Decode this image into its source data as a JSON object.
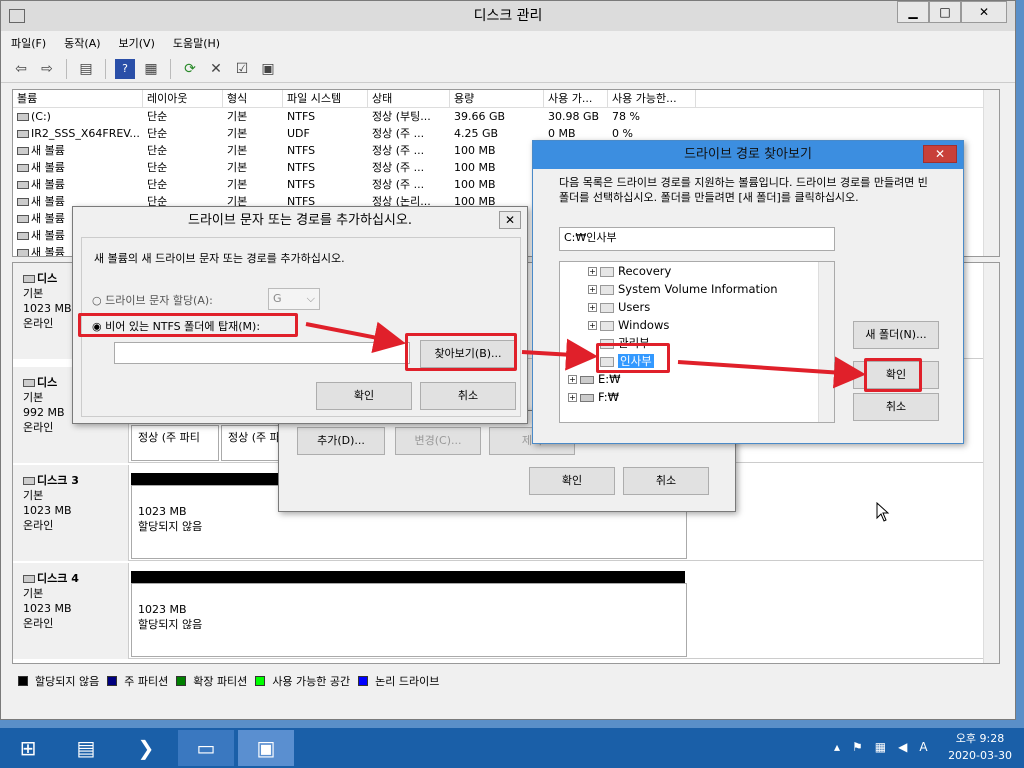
{
  "window": {
    "title": "디스크 관리",
    "min": "▁",
    "max": "□",
    "close": "✕"
  },
  "menu": [
    "파일(F)",
    "동작(A)",
    "보기(V)",
    "도움말(H)"
  ],
  "volumes": {
    "headers": [
      "볼륨",
      "레이아웃",
      "형식",
      "파일 시스템",
      "상태",
      "용량",
      "사용 가...",
      "사용 가능한..."
    ],
    "rows": [
      [
        "(C:)",
        "단순",
        "기본",
        "NTFS",
        "정상 (부팅...",
        "39.66 GB",
        "30.98 GB",
        "78 %"
      ],
      [
        "IR2_SSS_X64FREV...",
        "단순",
        "기본",
        "UDF",
        "정상 (주 ...",
        "4.25 GB",
        "0 MB",
        "0 %"
      ],
      [
        "새 볼륨",
        "단순",
        "기본",
        "NTFS",
        "정상 (주 ...",
        "100 MB",
        "",
        ""
      ],
      [
        "새 볼륨",
        "단순",
        "기본",
        "NTFS",
        "정상 (주 ...",
        "100 MB",
        "",
        ""
      ],
      [
        "새 볼륨",
        "단순",
        "기본",
        "NTFS",
        "정상 (주 ...",
        "100 MB",
        "",
        ""
      ],
      [
        "새 볼륨",
        "단순",
        "기본",
        "NTFS",
        "정상 (논리...",
        "100 MB",
        "",
        ""
      ],
      [
        "새 볼륨",
        "",
        "",
        "",
        "",
        "",
        "",
        ""
      ],
      [
        "새 볼륨",
        "",
        "",
        "",
        "",
        "",
        "",
        ""
      ],
      [
        "새 볼륨",
        "",
        "",
        "",
        "",
        "",
        "",
        ""
      ]
    ]
  },
  "disks": [
    {
      "name": "디스",
      "type": "기본",
      "size": "1023 MB",
      "status": "온라인"
    },
    {
      "name": "디스",
      "type": "기본",
      "size": "992 MB",
      "status": "온라인",
      "part1": "정상 (주 파티",
      "part2": "정상 (주 파"
    },
    {
      "name": "디스크 3",
      "type": "기본",
      "size": "1023 MB",
      "status": "온라인",
      "space": "1023 MB",
      "alloc": "할당되지 않음"
    },
    {
      "name": "디스크 4",
      "type": "기본",
      "size": "1023 MB",
      "status": "온라인",
      "space": "1023 MB",
      "alloc": "할당되지 않음"
    }
  ],
  "legend": [
    {
      "label": "할당되지 않음",
      "color": "#000000"
    },
    {
      "label": "주 파티션",
      "color": "#00007f"
    },
    {
      "label": "확장 파티션",
      "color": "#007f00"
    },
    {
      "label": "사용 가능한 공간",
      "color": "#00ff00"
    },
    {
      "label": "논리 드라이브",
      "color": "#0000ff"
    }
  ],
  "mid_dialog": {
    "add": "추가(D)...",
    "change": "변경(C)...",
    "remove": "제거",
    "ok": "확인",
    "cancel": "취소"
  },
  "add_dialog": {
    "title": "드라이브 문자 또는 경로를 추가하십시오.",
    "desc": "새 볼륨의 새 드라이브 문자 또는 경로를 추가하십시오.",
    "option_letter": "드라이브 문자 할당(A):",
    "letter_value": "G",
    "option_folder": "비어 있는 NTFS 폴더에 탑재(M):",
    "browse": "찾아보기(B)...",
    "ok": "확인",
    "cancel": "취소"
  },
  "browse_dialog": {
    "title": "드라이브 경로 찾아보기",
    "desc": "다음 목록은 드라이브 경로를 지원하는 볼륨입니다. 드라이브 경로를 만들려면 빈 폴더를 선택하십시오. 폴더를 만들려면 [새 폴더]를 클릭하십시오.",
    "path": "C:₩인사부",
    "tree": [
      "Recovery",
      "System Volume Information",
      "Users",
      "Windows",
      "관리부",
      "인사부",
      "E:₩",
      "F:₩"
    ],
    "new_folder": "새 폴더(N)...",
    "ok": "확인",
    "cancel": "취소"
  },
  "taskbar": {
    "time": "오후 9:28",
    "date": "2020-03-30"
  }
}
